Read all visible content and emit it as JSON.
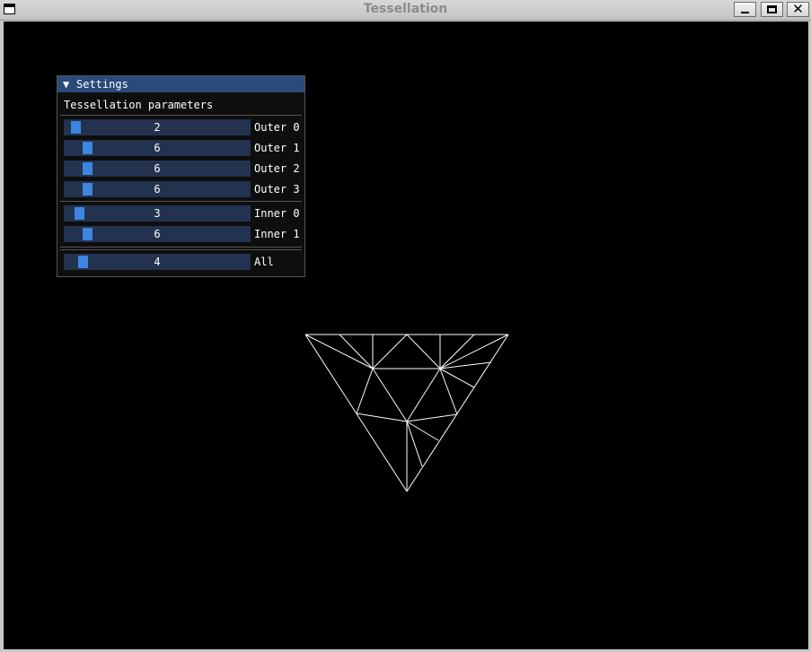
{
  "window": {
    "title": "Tessellation",
    "close_glyph": "✕"
  },
  "settings": {
    "header_arrow": "▼",
    "title": "Settings",
    "section_label": "Tessellation parameters",
    "outer": [
      {
        "label": "Outer 0",
        "value": "2",
        "fraction": 0.03
      },
      {
        "label": "Outer 1",
        "value": "6",
        "fraction": 0.1
      },
      {
        "label": "Outer 2",
        "value": "6",
        "fraction": 0.1
      },
      {
        "label": "Outer 3",
        "value": "6",
        "fraction": 0.1
      }
    ],
    "inner": [
      {
        "label": "Inner 0",
        "value": "3",
        "fraction": 0.05
      },
      {
        "label": "Inner 1",
        "value": "6",
        "fraction": 0.1
      }
    ],
    "all": {
      "label": "All",
      "value": "4",
      "fraction": 0.07
    }
  },
  "colors": {
    "background": "#000000",
    "mesh_stroke": "#ffffff",
    "panel_header": "#294a7a",
    "slider_frame": "#23324f",
    "slider_grab": "#3d85e0"
  },
  "icons": {
    "app": "window-icon",
    "minimize": "minimize-icon",
    "maximize": "maximize-icon",
    "close": "close-icon",
    "collapse": "collapse-arrow-icon"
  }
}
